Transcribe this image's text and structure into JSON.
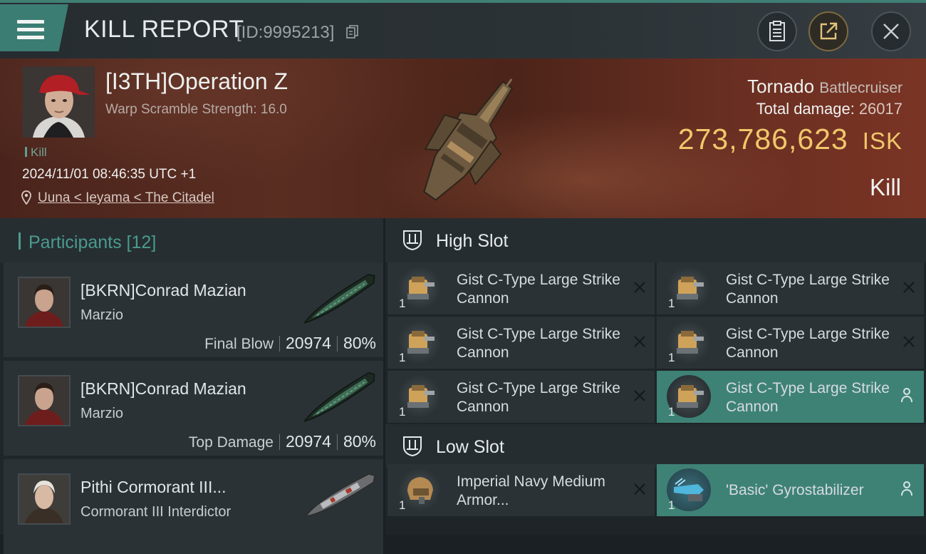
{
  "header": {
    "title": "KILL REPORT",
    "report_id": "[ID:9995213]"
  },
  "hero": {
    "pilot_name": "[I3TH]Operation Z",
    "warp_scramble": "Warp Scramble Strength: 16.0",
    "kill_tag": "Kill",
    "datetime": "2024/11/01 08:46:35 UTC +1",
    "location": "Uuna < Ieyama < The Citadel",
    "ship_name": "Tornado",
    "ship_class": "Battlecruiser",
    "total_damage_label": "Total damage:",
    "total_damage": "26017",
    "isk_value": "273,786,623",
    "isk_unit": "ISK",
    "result": "Kill"
  },
  "participants": {
    "title": "Participants [12]",
    "rows": [
      {
        "name": "[BKRN]Conrad Mazian",
        "ship": "Marzio",
        "role": "Final Blow",
        "damage": "20974",
        "percent": "80%"
      },
      {
        "name": "[BKRN]Conrad Mazian",
        "ship": "Marzio",
        "role": "Top Damage",
        "damage": "20974",
        "percent": "80%"
      },
      {
        "name": "Pithi Cormorant III...",
        "ship": "Cormorant III Interdictor"
      }
    ]
  },
  "fitting": {
    "high_slot_label": "High Slot",
    "low_slot_label": "Low Slot",
    "high_modules": [
      {
        "name": "Gist C-Type Large Strike Cannon",
        "qty": "1"
      },
      {
        "name": "Gist C-Type Large Strike Cannon",
        "qty": "1"
      },
      {
        "name": "Gist C-Type Large Strike Cannon",
        "qty": "1"
      },
      {
        "name": "Gist C-Type Large Strike Cannon",
        "qty": "1"
      },
      {
        "name": "Gist C-Type Large Strike Cannon",
        "qty": "1"
      },
      {
        "name": "Gist C-Type Large Strike Cannon",
        "qty": "1"
      }
    ],
    "low_modules": [
      {
        "name": "Imperial Navy Medium Armor...",
        "qty": "1"
      },
      {
        "name": "'Basic' Gyrostabilizer",
        "qty": "1"
      }
    ]
  },
  "icons": {
    "menu": "menu-icon",
    "copy": "copy-icon",
    "clipboard": "clipboard-icon",
    "share": "share-icon",
    "close": "close-icon",
    "location": "location-pin-icon",
    "slot": "slot-icon",
    "remove": "x-icon",
    "person": "person-icon"
  },
  "colors": {
    "accent": "#3e8276",
    "isk": "#f1c76b",
    "hero_bg": "#5a2d21"
  }
}
